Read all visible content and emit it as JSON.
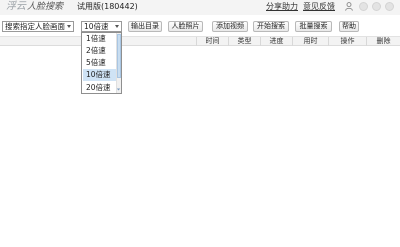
{
  "app": {
    "logo_main": "浮云",
    "logo_sub": "人脸搜索",
    "version": "试用版(180442)",
    "share_link": "分享助力",
    "feedback_link": "意见反馈"
  },
  "toolbar": {
    "search_mode_value": "搜索指定人脸画面",
    "speed_value": "10倍速",
    "export_label": "输出目录",
    "face_photo_label": "人脸照片",
    "add_video_label": "添加视频",
    "start_search_label": "开始搜索",
    "batch_search_label": "批量搜索",
    "help_label": "帮助"
  },
  "table": {
    "columns": [
      "时间",
      "类型",
      "进度",
      "用时",
      "操作",
      "删除"
    ]
  },
  "speed_dropdown": {
    "options": [
      "1倍速",
      "2倍速",
      "5倍速",
      "10倍速",
      "20倍速"
    ],
    "selected": "10倍速"
  },
  "colors": {
    "selected_option_bg": "#cfe3f5",
    "titlebar_bg": "#f4f4f4",
    "header_bg": "#f3f3f3"
  }
}
